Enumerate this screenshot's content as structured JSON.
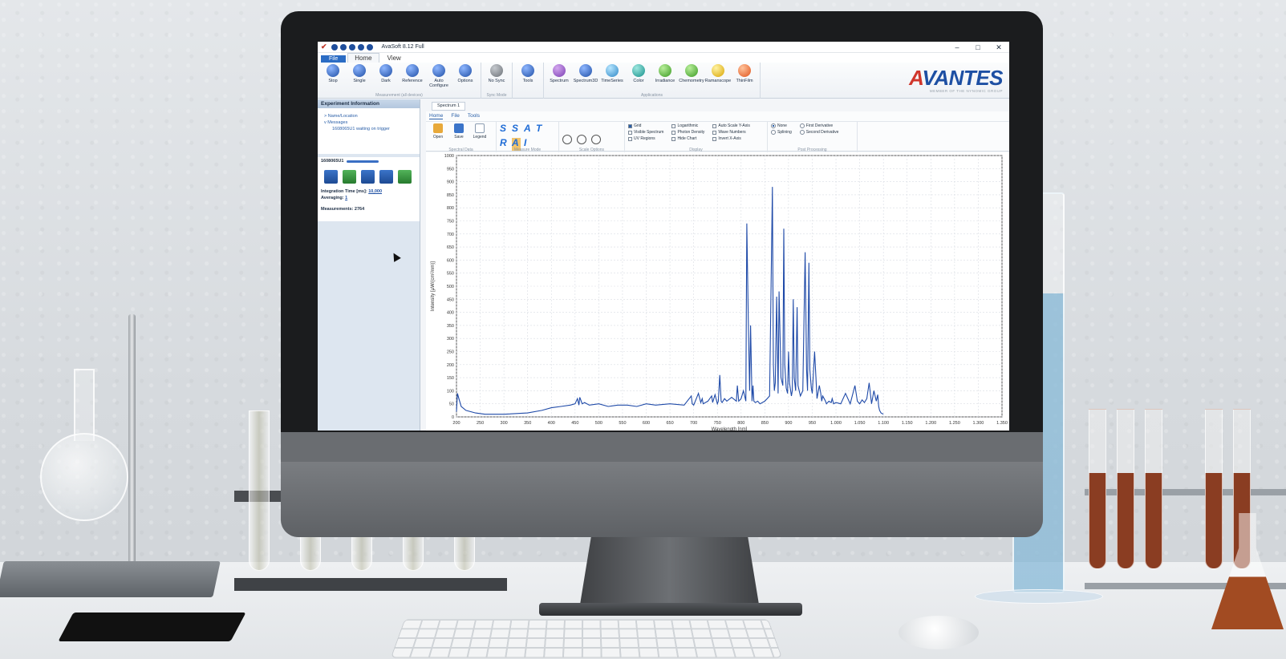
{
  "titlebar": {
    "title": "AvaSoft 8.12 Full",
    "min": "–",
    "max": "□",
    "close": "✕"
  },
  "menubar": {
    "file": "File",
    "tabs": [
      "Home",
      "View"
    ]
  },
  "ribbon": {
    "groups": [
      {
        "caption": "Measurement (all devices)",
        "buttons": [
          {
            "label": "Stop",
            "icon": "stop-icon",
            "color": "blue"
          },
          {
            "label": "Single",
            "icon": "single-icon",
            "color": "blue"
          },
          {
            "label": "Dark",
            "icon": "dark-icon",
            "color": "blue"
          },
          {
            "label": "Reference",
            "icon": "reference-icon",
            "color": "blue"
          },
          {
            "label": "Auto Configure",
            "icon": "auto-configure-icon",
            "color": "blue"
          },
          {
            "label": "Options",
            "icon": "options-icon",
            "color": "blue"
          }
        ]
      },
      {
        "caption": "Sync Mode",
        "buttons": [
          {
            "label": "No Sync",
            "icon": "no-sync-icon",
            "color": "grey"
          }
        ]
      },
      {
        "caption": "",
        "buttons": [
          {
            "label": "Tools",
            "icon": "tools-icon",
            "color": "blue"
          }
        ]
      },
      {
        "caption": "Applications",
        "buttons": [
          {
            "label": "Spectrum",
            "icon": "spectrum-icon",
            "color": "purple"
          },
          {
            "label": "Spectrum3D",
            "icon": "spectrum3d-icon",
            "color": "blue"
          },
          {
            "label": "TimeSeries",
            "icon": "timeseries-icon",
            "color": "cyan"
          },
          {
            "label": "Color",
            "icon": "color-icon",
            "color": "teal"
          },
          {
            "label": "Irradiance",
            "icon": "irradiance-icon",
            "color": "green"
          },
          {
            "label": "Chemometry",
            "icon": "chemometry-icon",
            "color": "green"
          },
          {
            "label": "Ramanscope",
            "icon": "ramanscope-icon",
            "color": "yellow"
          },
          {
            "label": "ThinFilm",
            "icon": "thinfilm-icon",
            "color": "orange"
          }
        ]
      }
    ]
  },
  "logo": {
    "name_a": "A",
    "name_rest": "VANTES",
    "tagline": "MEMBER OF THE NYNOMIC GROUP"
  },
  "left": {
    "header": "Experiment Information",
    "tree": [
      "> Name/Location",
      "v Messages",
      "1608065U1 waiting on trigger"
    ],
    "device": "1608065U1",
    "integration_label": "Integration Time [ms]:",
    "integration_value": "10,000",
    "averaging_label": "Averaging:",
    "averaging_value": "1",
    "measurements_label": "Measurements:",
    "measurements_value": "2764"
  },
  "doc": {
    "tab": "Spectrum 1",
    "menu": [
      "Home",
      "File",
      "Tools"
    ],
    "spectral_data": {
      "caption": "Spectral Data",
      "open": "Open",
      "save": "Save",
      "legend": "Legend"
    },
    "measure_mode": {
      "caption": "Measure Mode",
      "symbols": [
        "S",
        "S",
        "A",
        "T",
        "R",
        "A",
        "I"
      ]
    },
    "scale_caption": "Scale Options",
    "display": {
      "caption": "Display",
      "col1": [
        {
          "label": "Grid",
          "on": true
        },
        {
          "label": "Visible Spectrum",
          "on": false
        },
        {
          "label": "UV Regions",
          "on": false
        }
      ],
      "col2": [
        {
          "label": "Logarithmic",
          "on": false
        },
        {
          "label": "Photon Density",
          "on": false
        },
        {
          "label": "Hide Chart",
          "on": false
        }
      ],
      "col3": [
        {
          "label": "Auto Scale Y-Axis",
          "on": false
        },
        {
          "label": "Wave Numbers",
          "on": false
        },
        {
          "label": "Invert X-Axis",
          "on": false
        }
      ]
    },
    "post": {
      "caption": "Post Processing",
      "col1": [
        {
          "label": "None",
          "on": true
        },
        {
          "label": "Splining",
          "on": false
        }
      ],
      "col2": [
        {
          "label": "First Derivative",
          "on": false
        },
        {
          "label": "Second Derivative",
          "on": false
        }
      ]
    }
  },
  "chart_data": {
    "type": "line",
    "xlabel": "Wavelength [nm]",
    "ylabel": "Intensity [µW/(cm²/nm)]",
    "xlim": [
      200,
      1350
    ],
    "ylim": [
      0,
      1000
    ],
    "grid": true,
    "xticks": [
      200,
      250,
      300,
      350,
      400,
      450,
      500,
      550,
      600,
      650,
      700,
      750,
      800,
      850,
      900,
      950,
      1000,
      1050,
      1100,
      1150,
      1200,
      1250,
      1300,
      1350
    ],
    "xtick_labels": [
      "200",
      "250",
      "300",
      "350",
      "400",
      "450",
      "500",
      "550",
      "600",
      "650",
      "700",
      "750",
      "800",
      "850",
      "900",
      "950",
      "1.000",
      "1.050",
      "1.100",
      "1.150",
      "1.200",
      "1.250",
      "1.300",
      "1.350"
    ],
    "yticks": [
      0,
      50,
      100,
      150,
      200,
      250,
      300,
      350,
      400,
      450,
      500,
      550,
      600,
      650,
      700,
      750,
      800,
      850,
      900,
      950,
      1000
    ],
    "color": "#1f4aa8",
    "series": [
      {
        "x": [
          200,
          202,
          205,
          210,
          220,
          240,
          260,
          300,
          350,
          380,
          400,
          420,
          440,
          450,
          455,
          458,
          460,
          465,
          470,
          480,
          500,
          520,
          540,
          560,
          580,
          600,
          620,
          650,
          680,
          695,
          697,
          700,
          710,
          715,
          718,
          720,
          730,
          738,
          740,
          745,
          750,
          752,
          755,
          758,
          760,
          765,
          770,
          780,
          790,
          792,
          795,
          800,
          805,
          810,
          812,
          815,
          818,
          820,
          823,
          825,
          827,
          830,
          835,
          840,
          850,
          855,
          860,
          866,
          868,
          870,
          872,
          875,
          878,
          880,
          884,
          888,
          890,
          892,
          895,
          898,
          900,
          902,
          906,
          908,
          910,
          912,
          915,
          918,
          920,
          925,
          930,
          935,
          938,
          940,
          943,
          945,
          948,
          950,
          955,
          960,
          965,
          968,
          970,
          972,
          975,
          978,
          980,
          985,
          990,
          992,
          995,
          1000,
          1010,
          1020,
          1030,
          1040,
          1045,
          1050,
          1055,
          1060,
          1065,
          1070,
          1075,
          1080,
          1085,
          1088,
          1090,
          1092,
          1095,
          1100
        ],
        "y": [
          20,
          90,
          70,
          40,
          25,
          15,
          10,
          10,
          15,
          25,
          35,
          40,
          45,
          50,
          70,
          45,
          75,
          50,
          55,
          45,
          50,
          40,
          45,
          45,
          40,
          50,
          45,
          50,
          45,
          80,
          50,
          45,
          90,
          55,
          70,
          50,
          60,
          80,
          55,
          85,
          50,
          60,
          160,
          60,
          55,
          70,
          60,
          75,
          60,
          120,
          60,
          70,
          100,
          60,
          740,
          380,
          100,
          350,
          60,
          120,
          60,
          55,
          60,
          50,
          60,
          70,
          80,
          880,
          200,
          100,
          130,
          460,
          90,
          480,
          150,
          120,
          720,
          200,
          110,
          90,
          250,
          130,
          80,
          100,
          450,
          150,
          100,
          420,
          120,
          80,
          100,
          630,
          180,
          100,
          590,
          180,
          110,
          90,
          250,
          70,
          120,
          90,
          60,
          80,
          70,
          60,
          50,
          60,
          55,
          70,
          50,
          55,
          50,
          90,
          50,
          120,
          60,
          50,
          65,
          55,
          70,
          130,
          50,
          100,
          60,
          85,
          40,
          25,
          15,
          10
        ]
      }
    ]
  }
}
